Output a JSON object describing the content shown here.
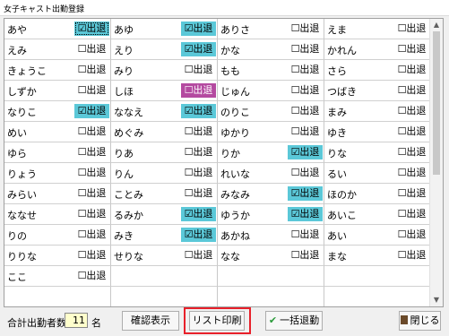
{
  "window": {
    "title": "女子キャスト出勤登録"
  },
  "columns": [
    [
      {
        "name": "あや",
        "label": "☑出退",
        "state": "on",
        "focus": true
      },
      {
        "name": "えみ",
        "label": "☐出退",
        "state": "off"
      },
      {
        "name": "きょうこ",
        "label": "☐出退",
        "state": "off"
      },
      {
        "name": "しずか",
        "label": "☐出退",
        "state": "off"
      },
      {
        "name": "なりこ",
        "label": "☑出退",
        "state": "on"
      },
      {
        "name": "めい",
        "label": "☐出退",
        "state": "off"
      },
      {
        "name": "ゆら",
        "label": "☐出退",
        "state": "off"
      },
      {
        "name": "りょう",
        "label": "☐出退",
        "state": "off"
      },
      {
        "name": "みらい",
        "label": "☐出退",
        "state": "off"
      },
      {
        "name": "ななせ",
        "label": "☐出退",
        "state": "off"
      },
      {
        "name": "りの",
        "label": "☐出退",
        "state": "off"
      },
      {
        "name": "りりな",
        "label": "☐出退",
        "state": "off"
      },
      {
        "name": "ここ",
        "label": "☐出退",
        "state": "off"
      }
    ],
    [
      {
        "name": "あゆ",
        "label": "☑出退",
        "state": "on"
      },
      {
        "name": "えり",
        "label": "☑出退",
        "state": "on"
      },
      {
        "name": "みり",
        "label": "☐出退",
        "state": "off"
      },
      {
        "name": "しほ",
        "label": "☐出退",
        "state": "warn"
      },
      {
        "name": "ななえ",
        "label": "☑出退",
        "state": "on"
      },
      {
        "name": "めぐみ",
        "label": "☐出退",
        "state": "off"
      },
      {
        "name": "りあ",
        "label": "☐出退",
        "state": "off"
      },
      {
        "name": "りん",
        "label": "☐出退",
        "state": "off"
      },
      {
        "name": "ことみ",
        "label": "☐出退",
        "state": "off"
      },
      {
        "name": "るみか",
        "label": "☑出退",
        "state": "on"
      },
      {
        "name": "みき",
        "label": "☑出退",
        "state": "on"
      },
      {
        "name": "せりな",
        "label": "☐出退",
        "state": "off"
      }
    ],
    [
      {
        "name": "ありさ",
        "label": "☐出退",
        "state": "off"
      },
      {
        "name": "かな",
        "label": "☐出退",
        "state": "off"
      },
      {
        "name": "もも",
        "label": "☐出退",
        "state": "off"
      },
      {
        "name": "じゅん",
        "label": "☐出退",
        "state": "off"
      },
      {
        "name": "のりこ",
        "label": "☐出退",
        "state": "off"
      },
      {
        "name": "ゆかり",
        "label": "☐出退",
        "state": "off"
      },
      {
        "name": "りか",
        "label": "☑出退",
        "state": "on"
      },
      {
        "name": "れいな",
        "label": "☐出退",
        "state": "off"
      },
      {
        "name": "みなみ",
        "label": "☑出退",
        "state": "on"
      },
      {
        "name": "ゆうか",
        "label": "☑出退",
        "state": "on"
      },
      {
        "name": "あかね",
        "label": "☐出退",
        "state": "off"
      },
      {
        "name": "なな",
        "label": "☐出退",
        "state": "off"
      }
    ],
    [
      {
        "name": "えま",
        "label": "☐出退",
        "state": "off"
      },
      {
        "name": "かれん",
        "label": "☐出退",
        "state": "off"
      },
      {
        "name": "さら",
        "label": "☐出退",
        "state": "off"
      },
      {
        "name": "つばき",
        "label": "☐出退",
        "state": "off"
      },
      {
        "name": "まみ",
        "label": "☐出退",
        "state": "off"
      },
      {
        "name": "ゆき",
        "label": "☐出退",
        "state": "off"
      },
      {
        "name": "りな",
        "label": "☐出退",
        "state": "off"
      },
      {
        "name": "るい",
        "label": "☐出退",
        "state": "off"
      },
      {
        "name": "ほのか",
        "label": "☐出退",
        "state": "off"
      },
      {
        "name": "あいこ",
        "label": "☐出退",
        "state": "off"
      },
      {
        "name": "あい",
        "label": "☐出退",
        "state": "off"
      },
      {
        "name": "まな",
        "label": "☐出退",
        "state": "off"
      }
    ]
  ],
  "footer": {
    "total_label": "合計出勤者数",
    "total_value": "11",
    "total_unit": "名",
    "confirm_label": "確認表示",
    "print_label": "リスト印刷",
    "bulk_label": "一括退勤",
    "close_label": "閉じる"
  },
  "colors": {
    "checked": "#5bc8d8",
    "warning": "#b44aa0",
    "highlight": "#e8202a"
  },
  "icons": {
    "bulk": "check-icon",
    "close": "door-icon"
  }
}
